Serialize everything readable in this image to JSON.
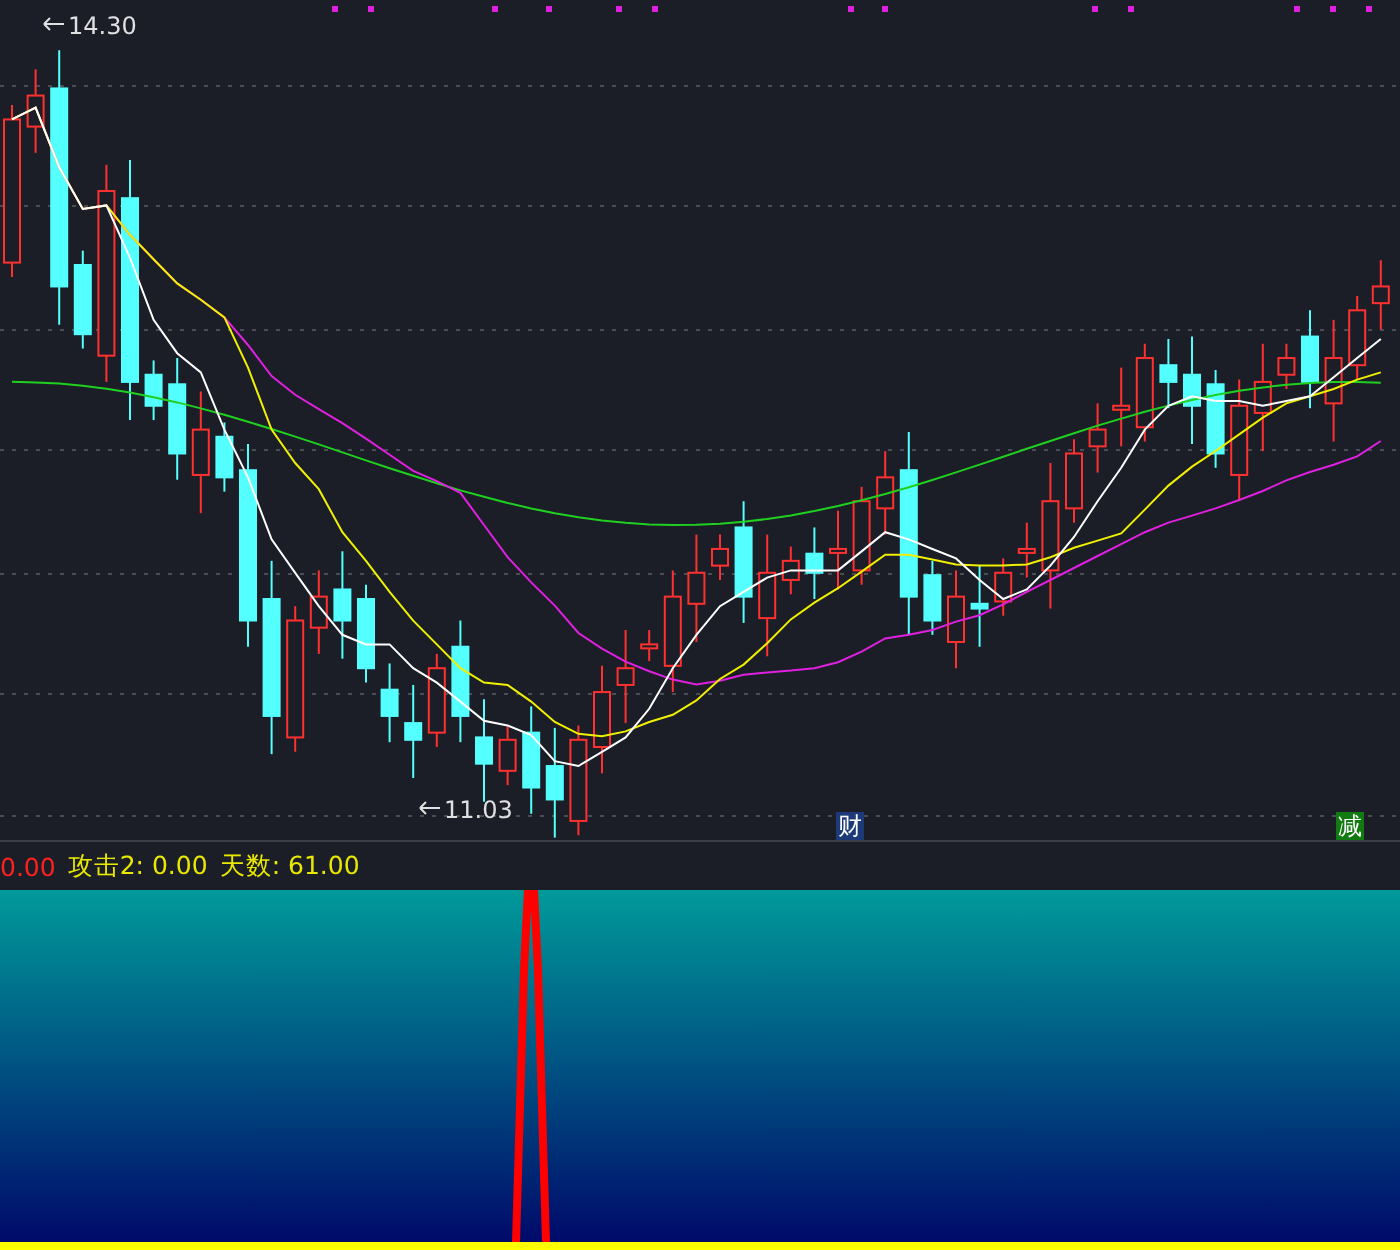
{
  "main_chart": {
    "high_label": "14.30",
    "low_label": "11.03",
    "markers": [
      {
        "text": "财",
        "color": "#1c3a78"
      },
      {
        "text": "减",
        "color": "#117a11"
      }
    ]
  },
  "legend": [
    {
      "text": "0.00",
      "color": "#ff2020"
    },
    {
      "text": "攻击2: 0.00",
      "color": "#e8e800"
    },
    {
      "text": "天数: 61.00",
      "color": "#e8e800"
    }
  ]
}
